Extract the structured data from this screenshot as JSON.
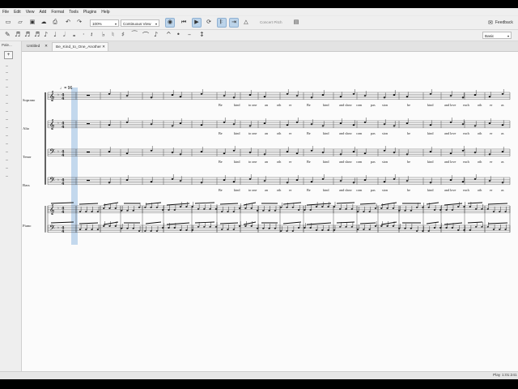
{
  "menu": [
    "File",
    "Edit",
    "View",
    "Add",
    "Format",
    "Tools",
    "Plugins",
    "Help"
  ],
  "toolbar": {
    "zoom": "100%",
    "view_mode": "Continuous View",
    "concert_pitch": "Concert Pitch",
    "feedback": "Feedback"
  },
  "note_input": {
    "voice": "Basic"
  },
  "sidebar": {
    "title": "Pale...",
    "add": "+"
  },
  "tabs": [
    {
      "label": "Untitled",
      "close": "✕"
    },
    {
      "label": "Be_Kind_to_One_Another",
      "close": "✕"
    }
  ],
  "score": {
    "tempo": "♩= 96",
    "instruments": [
      "Soprano",
      "Alto",
      "Tenor",
      "Bass",
      "Piano"
    ],
    "lyrics_line": [
      "Be",
      "kind",
      "to one",
      "an",
      "oth",
      "er",
      "Be",
      "kind",
      "and show",
      "com",
      "pas",
      "sion",
      "be",
      "kind",
      "and love",
      "each",
      "oth",
      "er",
      "as"
    ]
  },
  "status": {
    "mode": "Play",
    "time": "1:01:241"
  },
  "colors": {
    "playback_cursor": "#b9d1ea",
    "active_button": "#bcd4ea"
  }
}
